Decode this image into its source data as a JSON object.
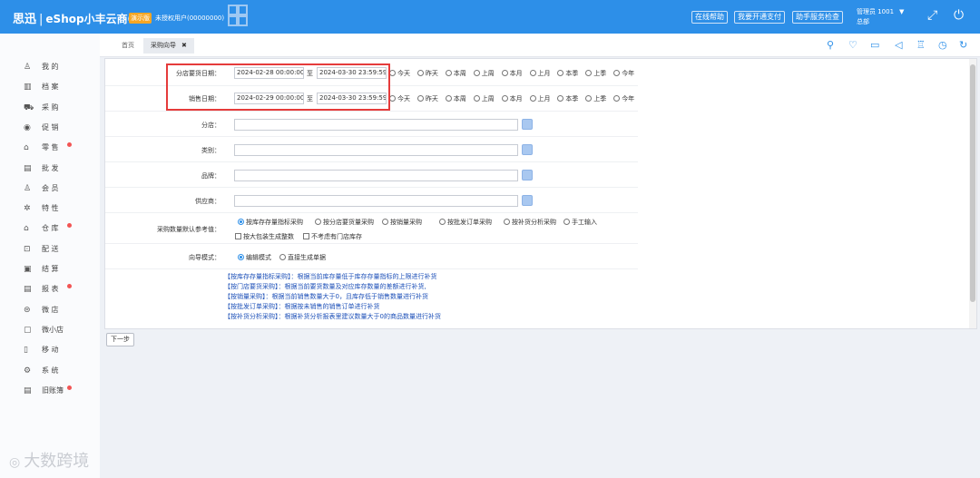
{
  "topbar": {
    "brand": "思迅",
    "product": "eShop小丰云商6",
    "demo_badge": "演示版",
    "license": "未授权用户(00000000)",
    "buttons": [
      "在线帮助",
      "我要开通支付",
      "助手服务检查"
    ],
    "user_line1": "管理员 1001",
    "user_line2": "总部",
    "caret": "▼",
    "icons": [
      "expand-icon",
      "power-icon"
    ]
  },
  "sidebar": {
    "items": [
      {
        "label": "我 的",
        "icon": "user-icon",
        "glyph": "♙",
        "dot": false
      },
      {
        "label": "档 案",
        "icon": "archive-icon",
        "glyph": "▥",
        "dot": false
      },
      {
        "label": "采 购",
        "icon": "purchase-icon",
        "glyph": "⛟",
        "dot": false
      },
      {
        "label": "促 销",
        "icon": "promotion-icon",
        "glyph": "◉",
        "dot": false
      },
      {
        "label": "零 售",
        "icon": "retail-icon",
        "glyph": "⌂",
        "dot": true
      },
      {
        "label": "批 发",
        "icon": "wholesale-icon",
        "glyph": "▤",
        "dot": false
      },
      {
        "label": "会 员",
        "icon": "member-icon",
        "glyph": "♙",
        "dot": false
      },
      {
        "label": "特 性",
        "icon": "feature-icon",
        "glyph": "✲",
        "dot": false
      },
      {
        "label": "仓 库",
        "icon": "warehouse-icon",
        "glyph": "⌂",
        "dot": true
      },
      {
        "label": "配 送",
        "icon": "delivery-icon",
        "glyph": "⊡",
        "dot": false
      },
      {
        "label": "结 算",
        "icon": "settlement-icon",
        "glyph": "▣",
        "dot": false
      },
      {
        "label": "报 表",
        "icon": "report-icon",
        "glyph": "▤",
        "dot": true
      },
      {
        "label": "微 店",
        "icon": "micro-store-icon",
        "glyph": "⊜",
        "dot": false
      },
      {
        "label": "微小店",
        "icon": "mini-store-icon",
        "glyph": "▢",
        "dot": false
      },
      {
        "label": "移 动",
        "icon": "mobile-icon",
        "glyph": "▯",
        "dot": false
      },
      {
        "label": "系 统",
        "icon": "system-icon",
        "glyph": "⚙",
        "dot": false
      },
      {
        "label": "旧账簿",
        "icon": "ledger-icon",
        "glyph": "▤",
        "dot": true
      }
    ]
  },
  "watermark": "大数跨境",
  "tabs": [
    {
      "label": "首页",
      "active": false
    },
    {
      "label": "采购向导",
      "active": true,
      "close": "✖"
    }
  ],
  "toolbar_icons": [
    "search-icon",
    "heart-icon",
    "folder-icon",
    "speaker-icon",
    "alarm-icon",
    "clock-icon",
    "refresh-icon"
  ],
  "form": {
    "order_date": {
      "label": "分店要货日期：",
      "from": "2024-02-28 00:00:00",
      "to": "2024-03-30 23:59:59",
      "to_label": "至"
    },
    "sales_date": {
      "label": "销售日期：",
      "from": "2024-02-29 00:00:00",
      "to": "2024-03-30 23:59:59",
      "to_label": "至"
    },
    "period_options": [
      "今天",
      "昨天",
      "本周",
      "上周",
      "本月",
      "上月",
      "本季",
      "上季",
      "今年"
    ],
    "branch_label": "分店：",
    "category_label": "类别：",
    "brand_label": "品牌：",
    "supplier_label": "供应商：",
    "ref_label": "采购数量默认参考值：",
    "ref_options": [
      "按库存存量指标采购",
      "按分店要货量采购",
      "按销量采购",
      "按批发订单采购",
      "按补货分析采购",
      "手工输入"
    ],
    "ref_selected": 0,
    "checks": [
      "按大包装生成整数",
      "不考虑有门店库存"
    ],
    "mode_label": "向导模式：",
    "mode_options": [
      "编辑模式",
      "直接生成单据"
    ],
    "mode_selected": 0,
    "notes": [
      "【按库存存量指标采购】：根据当前库存量低于库存存量指标的上限进行补货",
      "【按门店要货采购】：根据当前要货数量及对应库存数量的差额进行补货,",
      "【按销量采购】：根据当前销售数量大于0，且库存低于销售数量进行补货",
      "【按批发订单采购】：根据按未销售的销售订单进行补货",
      "【按补货分析采购】：根据补货分析报表里建议数量大于0的商品数量进行补货"
    ]
  },
  "next_button": "下一步",
  "colors": {
    "primary": "#2d8fe8",
    "highlight": "#e53b3b",
    "note": "#1d50b8"
  }
}
